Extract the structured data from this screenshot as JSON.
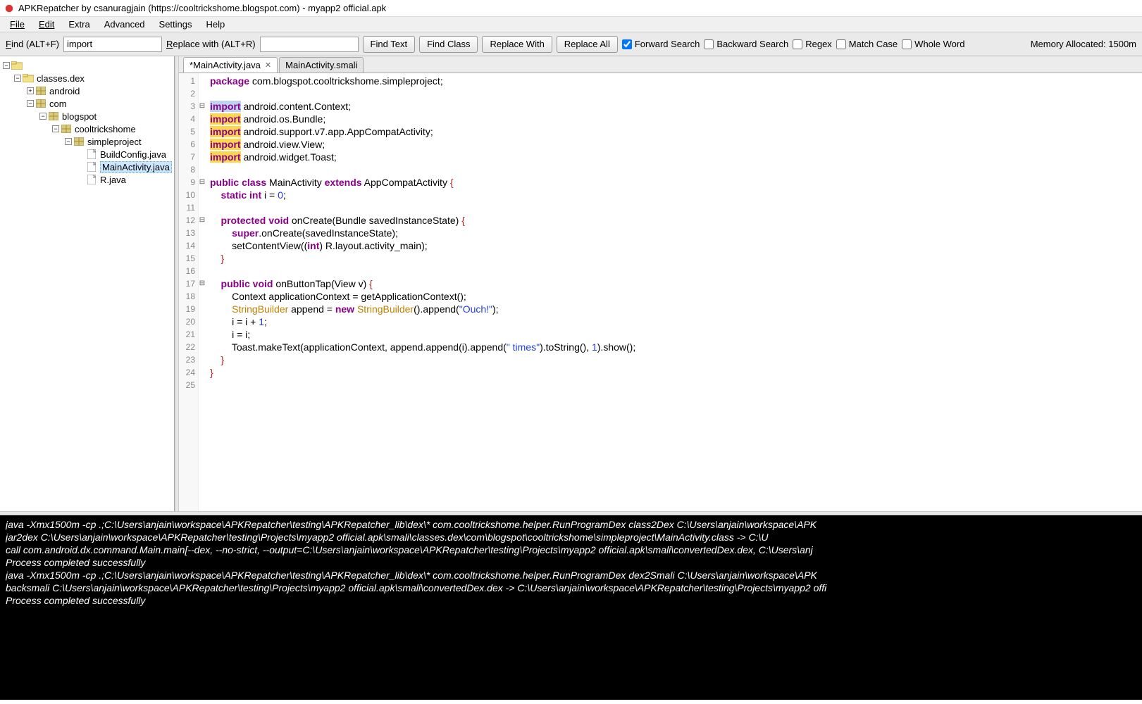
{
  "window": {
    "title": "APKRepatcher by csanuragjain (https://cooltrickshome.blogspot.com) - myapp2 official.apk"
  },
  "menubar": {
    "file": "File",
    "edit": "Edit",
    "extra": "Extra",
    "advanced": "Advanced",
    "settings": "Settings",
    "help": "Help"
  },
  "toolbar": {
    "find_label": "Find (ALT+F)",
    "find_value": "import",
    "replace_label": "Replace with (ALT+R)",
    "replace_value": "",
    "find_text_btn": "Find Text",
    "find_class_btn": "Find Class",
    "replace_with_btn": "Replace With",
    "replace_all_btn": "Replace All",
    "forward_search": "Forward Search",
    "backward_search": "Backward Search",
    "regex": "Regex",
    "match_case": "Match Case",
    "whole_word": "Whole Word",
    "memory": "Memory Allocated: 1500m"
  },
  "tree": {
    "root": "",
    "classes": "classes.dex",
    "android": "android",
    "com": "com",
    "blogspot": "blogspot",
    "cooltrickshome": "cooltrickshome",
    "simpleproject": "simpleproject",
    "buildconfig": "BuildConfig.java",
    "mainactivity": "MainActivity.java",
    "rjava": "R.java"
  },
  "tabs": {
    "active": "*MainActivity.java",
    "other": "MainActivity.smali"
  },
  "code": {
    "l1_a": "package",
    "l1_b": " com.blogspot.cooltrickshome.simpleproject;",
    "l3_a": "import",
    "l3_b": " android.content.Context;",
    "l4_a": "import",
    "l4_b": " android.os.Bundle;",
    "l5_a": "import",
    "l5_b": " android.support.v7.app.AppCompatActivity;",
    "l6_a": "import",
    "l6_b": " android.view.View;",
    "l7_a": "import",
    "l7_b": " android.widget.Toast;",
    "l9_a": "public",
    "l9_b": " class",
    "l9_c": " MainActivity ",
    "l9_d": "extends",
    "l9_e": " AppCompatActivity ",
    "l9_f": "{",
    "l10_a": "    static",
    "l10_b": " int",
    "l10_c": " i = ",
    "l10_d": "0",
    "l10_e": ";",
    "l12_a": "    protected",
    "l12_b": " void",
    "l12_c": " onCreate(Bundle savedInstanceState) ",
    "l12_d": "{",
    "l13_a": "        super",
    "l13_b": ".onCreate(savedInstanceState);",
    "l14_a": "        setContentView((",
    "l14_b": "int",
    "l14_c": ") R.layout.activity_main);",
    "l15_a": "    }",
    "l17_a": "    public",
    "l17_b": " void",
    "l17_c": " onButtonTap(View v) ",
    "l17_d": "{",
    "l18_a": "        Context applicationContext = getApplicationContext();",
    "l19_a": "        ",
    "l19_b": "StringBuilder",
    "l19_c": " append = ",
    "l19_d": "new",
    "l19_e": " ",
    "l19_f": "StringBuilder",
    "l19_g": "().append(",
    "l19_h": "\"Ouch!\"",
    "l19_i": ");",
    "l20_a": "        i = i + ",
    "l20_b": "1",
    "l20_c": ";",
    "l21_a": "        i = i;",
    "l22_a": "        Toast.makeText(applicationContext, append.append(i).append(",
    "l22_b": "\" times\"",
    "l22_c": ").toString(), ",
    "l22_d": "1",
    "l22_e": ").show();",
    "l23_a": "    }",
    "l24_a": "}"
  },
  "line_numbers": [
    "1",
    "2",
    "3",
    "4",
    "5",
    "6",
    "7",
    "8",
    "9",
    "10",
    "11",
    "12",
    "13",
    "14",
    "15",
    "16",
    "17",
    "18",
    "19",
    "20",
    "21",
    "22",
    "23",
    "24",
    "25"
  ],
  "console": {
    "c1": "java -Xmx1500m -cp .;C:\\Users\\anjain\\workspace\\APKRepatcher\\testing\\APKRepatcher_lib\\dex\\* com.cooltrickshome.helper.RunProgramDex class2Dex C:\\Users\\anjain\\workspace\\APK",
    "c2": "jar2dex C:\\Users\\anjain\\workspace\\APKRepatcher\\testing\\Projects\\myapp2 official.apk\\smali\\classes.dex\\com\\blogspot\\cooltrickshome\\simpleproject\\MainActivity.class -> C:\\U",
    "c3": "call com.android.dx.command.Main.main[--dex, --no-strict, --output=C:\\Users\\anjain\\workspace\\APKRepatcher\\testing\\Projects\\myapp2 official.apk\\smali\\convertedDex.dex, C:\\Users\\anj",
    "c4": "Process completed successfully",
    "c5": "java -Xmx1500m -cp .;C:\\Users\\anjain\\workspace\\APKRepatcher\\testing\\APKRepatcher_lib\\dex\\* com.cooltrickshome.helper.RunProgramDex dex2Smali C:\\Users\\anjain\\workspace\\APK",
    "c6": "backsmali C:\\Users\\anjain\\workspace\\APKRepatcher\\testing\\Projects\\myapp2 official.apk\\smali\\convertedDex.dex -> C:\\Users\\anjain\\workspace\\APKRepatcher\\testing\\Projects\\myapp2 offi",
    "c7": "Process completed successfully"
  }
}
